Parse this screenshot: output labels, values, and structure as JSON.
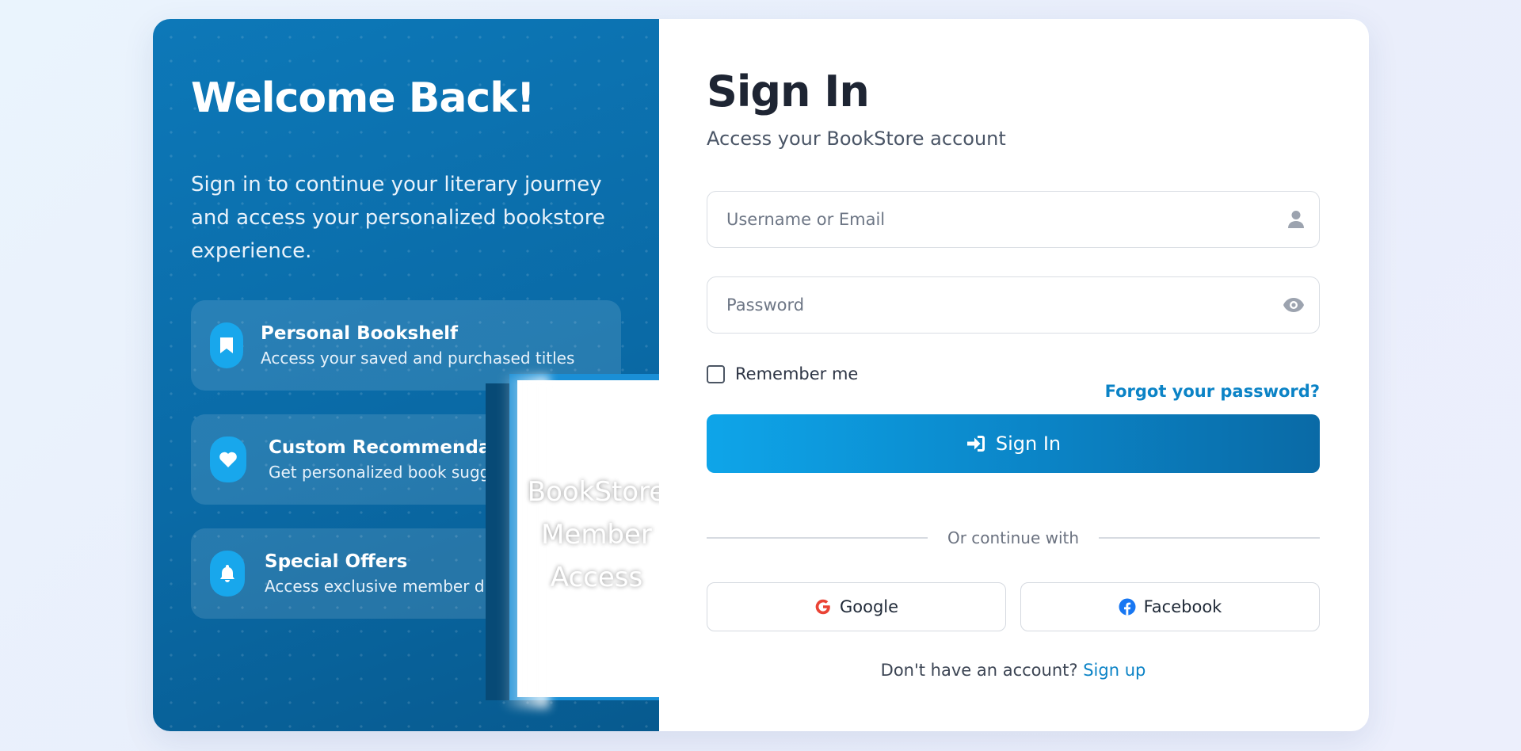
{
  "welcome": {
    "title": "Welcome Back!",
    "subtitle": "Sign in to continue your literary journey and access your personalized bookstore experience."
  },
  "features": [
    {
      "icon": "bookmark-icon",
      "title": "Personal Bookshelf",
      "desc": "Access your saved and purchased titles"
    },
    {
      "icon": "heart-icon",
      "title": "Custom Recommendations",
      "desc": "Get personalized book suggestions"
    },
    {
      "icon": "bell-icon",
      "title": "Special Offers",
      "desc": "Access exclusive member discounts"
    }
  ],
  "book_image": {
    "lines": [
      "BookStore",
      "Member",
      "Access"
    ]
  },
  "form": {
    "title": "Sign In",
    "subtitle": "Access your BookStore account",
    "username_placeholder": "Username or Email",
    "username_value": "",
    "password_placeholder": "Password",
    "password_value": "",
    "remember_label": "Remember me",
    "remember_checked": false,
    "forgot_label": "Forgot your password?",
    "submit_label": "Sign In",
    "divider_text": "Or continue with",
    "google_label": "Google",
    "facebook_label": "Facebook",
    "signup_prompt": "Don't have an account?",
    "signup_link": "Sign up"
  },
  "colors": {
    "primary": "#0b83c6",
    "panel": "#0a6aa6",
    "accent_icon_bg": "#18a7ec",
    "google_red": "#ea4335",
    "facebook_blue": "#1877f2"
  }
}
